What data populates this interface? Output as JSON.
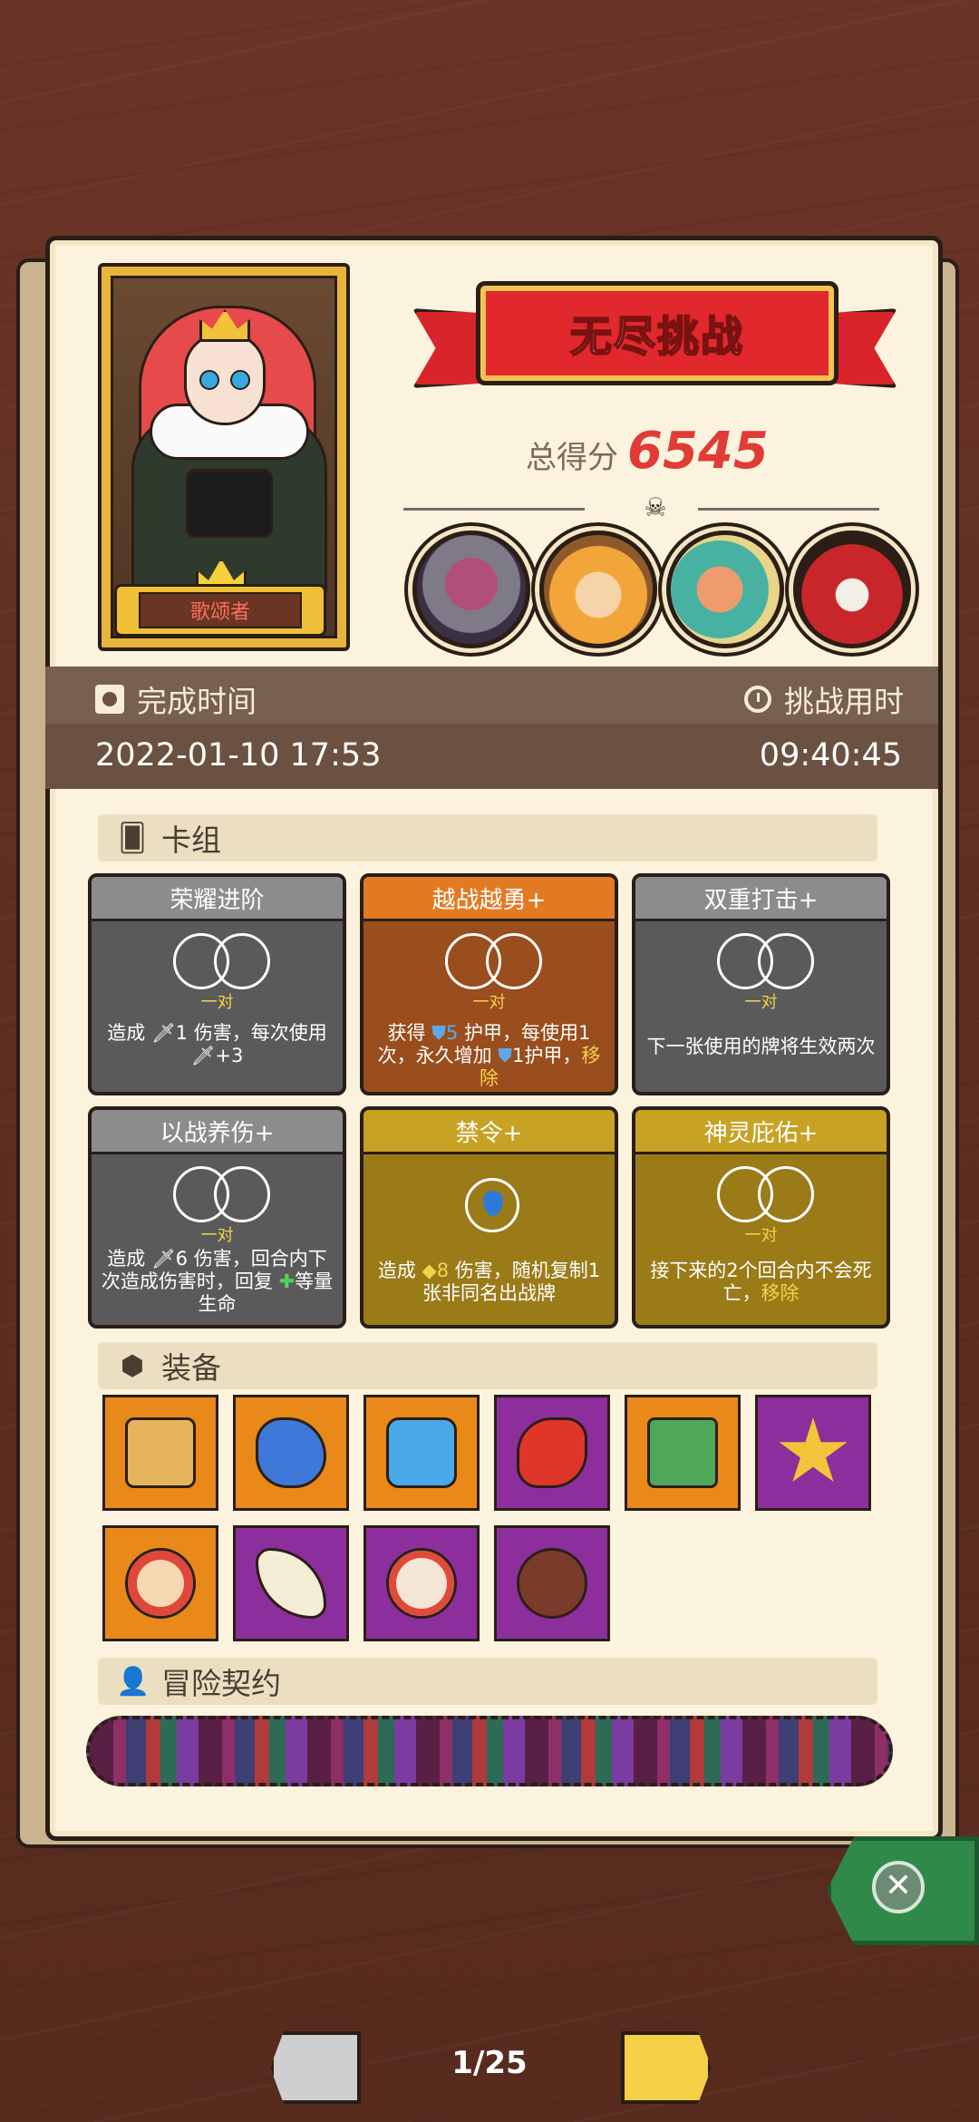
{
  "hero": {
    "name": "歌颂者"
  },
  "banner": {
    "title": "无尽挑战"
  },
  "score": {
    "label": "总得分",
    "value": "6545"
  },
  "bosses": [
    "boss-1",
    "boss-2",
    "boss-3",
    "boss-4"
  ],
  "time": {
    "complete_label": "完成时间",
    "complete_value": "2022-01-10 17:53",
    "challenge_label": "挑战用时",
    "challenge_value": "09:40:45"
  },
  "sections": {
    "deck": "卡组",
    "equipment": "装备",
    "contract": "冒险契约"
  },
  "cards": [
    {
      "title": "荣耀进阶",
      "pair": "一对",
      "desc_a": "造成 ",
      "desc_num": "1",
      "desc_b": " 伤害，每次使用",
      "desc_c": "+3"
    },
    {
      "title": "越战越勇+",
      "pair": "一对",
      "desc_a": "获得 ",
      "desc_num": "5",
      "desc_b": " 护甲，每使用1次，永久增加 ",
      "desc_c": "1护甲，",
      "desc_d": "移除"
    },
    {
      "title": "双重打击+",
      "pair": "一对",
      "desc": "下一张使用的牌将生效两次"
    },
    {
      "title": "以战养伤+",
      "pair": "一对",
      "desc_a": "造成 ",
      "desc_num": "6",
      "desc_b": " 伤害，回合内下次造成伤害时，回复 ",
      "desc_c": "等量生命"
    },
    {
      "title": "禁令+",
      "desc_a": "造成 ",
      "desc_num": "8",
      "desc_b": " 伤害，随机复制1张非同名出战牌"
    },
    {
      "title": "神灵庇佑+",
      "pair": "一对",
      "desc_a": "接下来的2个回合内不会死亡，",
      "desc_d": "移除"
    }
  ],
  "pager": {
    "current": "1/25"
  },
  "colors": {
    "accent": "#e03b35",
    "gold": "#f5d34a",
    "panel": "#fbf3dd",
    "wood": "#5d2e21"
  }
}
